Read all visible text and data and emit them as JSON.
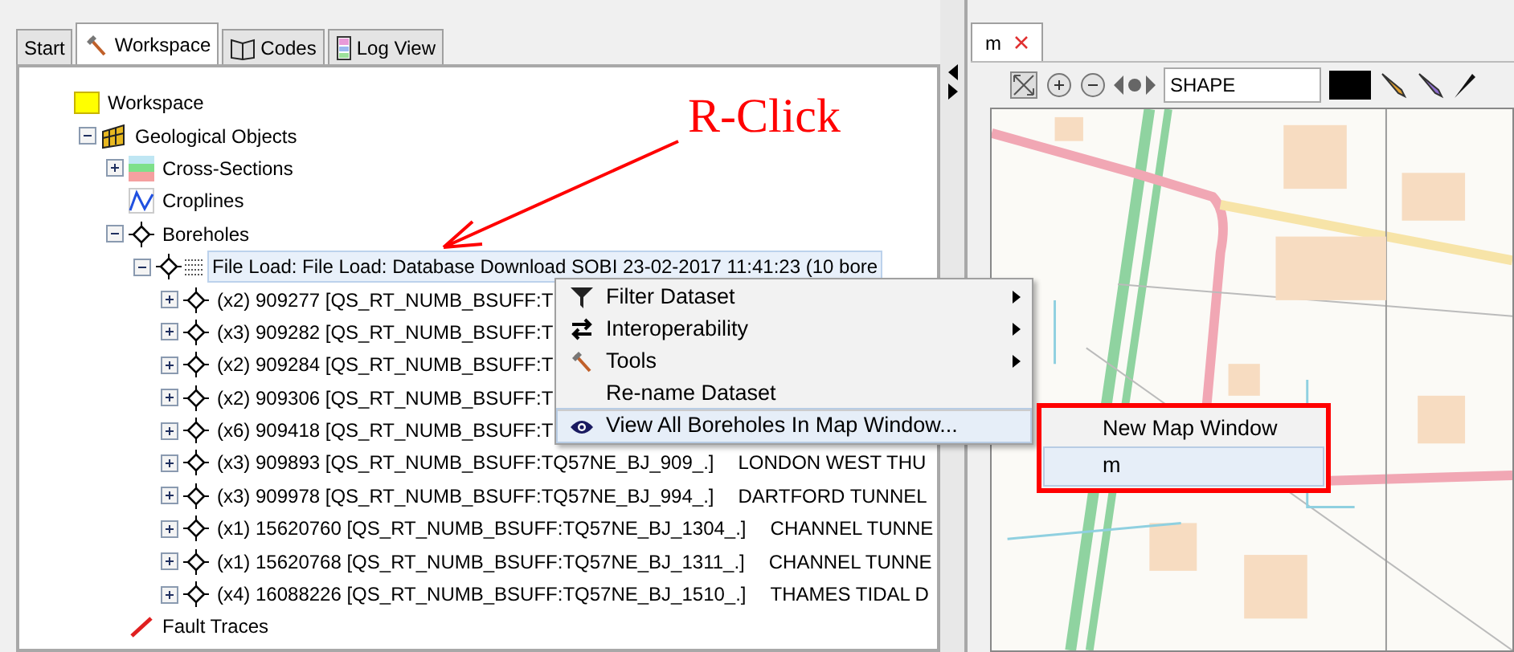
{
  "left_tabs": [
    {
      "label": "Start",
      "kind": "plain",
      "selected": false
    },
    {
      "label": "Workspace",
      "kind": "hammer",
      "selected": true
    },
    {
      "label": "Codes",
      "kind": "book",
      "selected": false
    },
    {
      "label": "Log View",
      "kind": "log",
      "selected": false
    }
  ],
  "tree": [
    {
      "label": "Workspace",
      "kind": "folder",
      "selected": false,
      "children": [
        {
          "label": "Geological Objects",
          "kind": "geology",
          "expanded": true,
          "selected": false,
          "children": [
            {
              "label": "Cross-Sections",
              "kind": "sections",
              "expanded": false,
              "selected": false
            },
            {
              "label": "Croplines",
              "kind": "croplines",
              "selected": false
            },
            {
              "label": "Boreholes",
              "kind": "borehole",
              "expanded": true,
              "selected": false,
              "children": [
                {
                  "label": "File Load: File Load: Database Download SOBI 23-02-2017 11:41:23 (10 bore",
                  "kind": "dataset",
                  "expanded": true,
                  "selected": true,
                  "children": [
                    {
                      "label": "(x2) 909277 [QS_RT_NUMB_BSUFF:T",
                      "kind": "borehole",
                      "expanded": false,
                      "selected": false
                    },
                    {
                      "label": "(x3) 909282 [QS_RT_NUMB_BSUFF:T",
                      "kind": "borehole",
                      "expanded": false,
                      "selected": false
                    },
                    {
                      "label": "(x2) 909284 [QS_RT_NUMB_BSUFF:T",
                      "kind": "borehole",
                      "expanded": false,
                      "selected": false
                    },
                    {
                      "label": "(x2) 909306 [QS_RT_NUMB_BSUFF:T",
                      "kind": "borehole",
                      "expanded": false,
                      "selected": false
                    },
                    {
                      "label": "(x6) 909418 [QS_RT_NUMB_BSUFF:T",
                      "kind": "borehole",
                      "expanded": false,
                      "selected": false
                    },
                    {
                      "label": "(x3) 909893 [QS_RT_NUMB_BSUFF:TQ57NE_BJ_909_.]",
                      "description": "LONDON WEST THU",
                      "kind": "borehole",
                      "expanded": false,
                      "selected": false
                    },
                    {
                      "label": "(x3) 909978 [QS_RT_NUMB_BSUFF:TQ57NE_BJ_994_.]",
                      "description": "DARTFORD TUNNEL",
                      "kind": "borehole",
                      "expanded": false,
                      "selected": false
                    },
                    {
                      "label": "(x1) 15620760 [QS_RT_NUMB_BSUFF:TQ57NE_BJ_1304_.]",
                      "description": "CHANNEL TUNNE",
                      "kind": "borehole",
                      "expanded": false,
                      "selected": false
                    },
                    {
                      "label": "(x1) 15620768 [QS_RT_NUMB_BSUFF:TQ57NE_BJ_1311_.]",
                      "description": "CHANNEL TUNNE",
                      "kind": "borehole",
                      "expanded": false,
                      "selected": false
                    },
                    {
                      "label": "(x4) 16088226 [QS_RT_NUMB_BSUFF:TQ57NE_BJ_1510_.]",
                      "description": "THAMES TIDAL D",
                      "kind": "borehole",
                      "expanded": false,
                      "selected": false
                    }
                  ]
                }
              ]
            },
            {
              "label": "Fault Traces",
              "kind": "fault",
              "selected": false
            }
          ]
        }
      ]
    }
  ],
  "annotation": {
    "text": "R-Click"
  },
  "context_menu": [
    {
      "label": "Filter Dataset",
      "kind": "filter",
      "submenu": true,
      "selected": false
    },
    {
      "label": "Interoperability",
      "kind": "swap",
      "submenu": true,
      "selected": false
    },
    {
      "label": "Tools",
      "kind": "hammer",
      "submenu": true,
      "selected": false
    },
    {
      "label": "Re-name Dataset",
      "kind": "plain",
      "submenu": false,
      "selected": false
    },
    {
      "label": "View All Boreholes In Map Window...",
      "kind": "eye",
      "submenu": false,
      "selected": true
    }
  ],
  "submenu": [
    {
      "label": "New Map Window",
      "selected": false
    },
    {
      "label": "m",
      "selected": true
    }
  ],
  "map_tabs": [
    {
      "label": "m",
      "closable": true,
      "selected": true
    }
  ],
  "map_toolbar": {
    "layer_field": "SHAPE"
  }
}
